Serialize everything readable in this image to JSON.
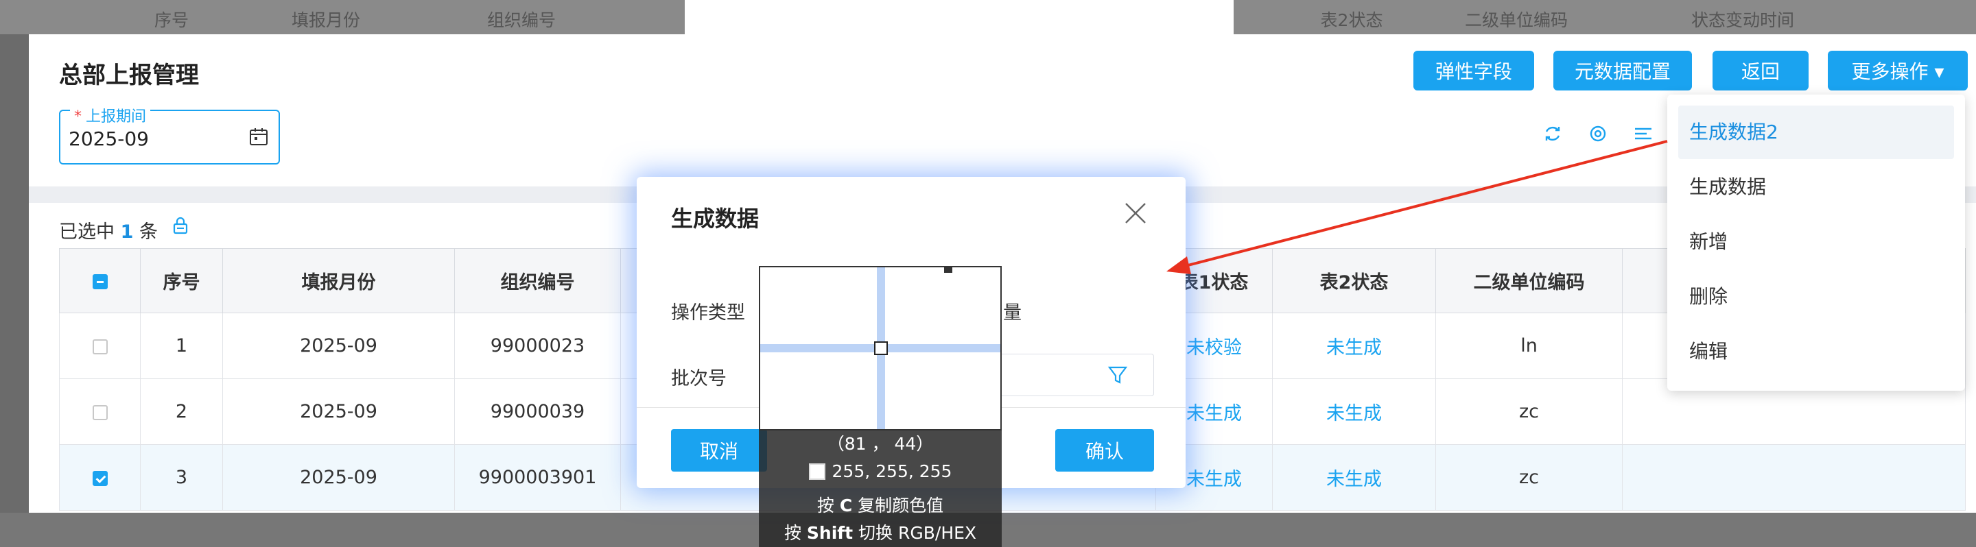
{
  "background_header": {
    "cells": [
      "序号",
      "填报月份",
      "组织编号",
      "表2状态",
      "二级单位编码",
      "状态变动时间"
    ]
  },
  "page": {
    "title": "总部上报管理",
    "buttons": {
      "flex_fields": "弹性字段",
      "metadata_config": "元数据配置",
      "back": "返回",
      "more_actions": "更多操作 ▾"
    },
    "period": {
      "label": "上报期间",
      "required_mark": "*",
      "value": "2025-09"
    }
  },
  "table": {
    "selection_prefix": "已选中 ",
    "selection_count": "1",
    "selection_suffix": " 条",
    "columns": [
      "序号",
      "填报月份",
      "组织编号",
      "表1状态",
      "表2状态",
      "二级单位编码"
    ],
    "rows": [
      {
        "index": "1",
        "month": "2025-09",
        "org": "99000023",
        "t1": "未校验",
        "t2": "未生成",
        "code": "ln",
        "checked": false
      },
      {
        "index": "2",
        "month": "2025-09",
        "org": "99000039",
        "t1": "未生成",
        "t2": "未生成",
        "code": "zc",
        "checked": false
      },
      {
        "index": "3",
        "month": "2025-09",
        "org": "9900003901",
        "t1": "未生成",
        "t2": "未生成",
        "code": "zc",
        "checked": true
      }
    ]
  },
  "dialog": {
    "title": "生成数据",
    "operation_type_label": "操作类型",
    "operation_type_value_fragment": "量",
    "batch_label": "批次号",
    "cancel": "取消",
    "confirm": "确认"
  },
  "color_picker": {
    "coords": "（81 ， 44）",
    "rgb": "255, 255, 255",
    "hint_copy_prefix": "按 ",
    "hint_copy_key": "C",
    "hint_copy_suffix": " 复制颜色值",
    "hint_switch_prefix": "按 ",
    "hint_switch_key": "Shift",
    "hint_switch_suffix": " 切换 RGB/HEX"
  },
  "dropdown": {
    "items": [
      "生成数据2",
      "生成数据",
      "新增",
      "删除",
      "编辑"
    ]
  },
  "colors": {
    "primary": "#1aa3f0",
    "arrow": "#e8311f"
  }
}
